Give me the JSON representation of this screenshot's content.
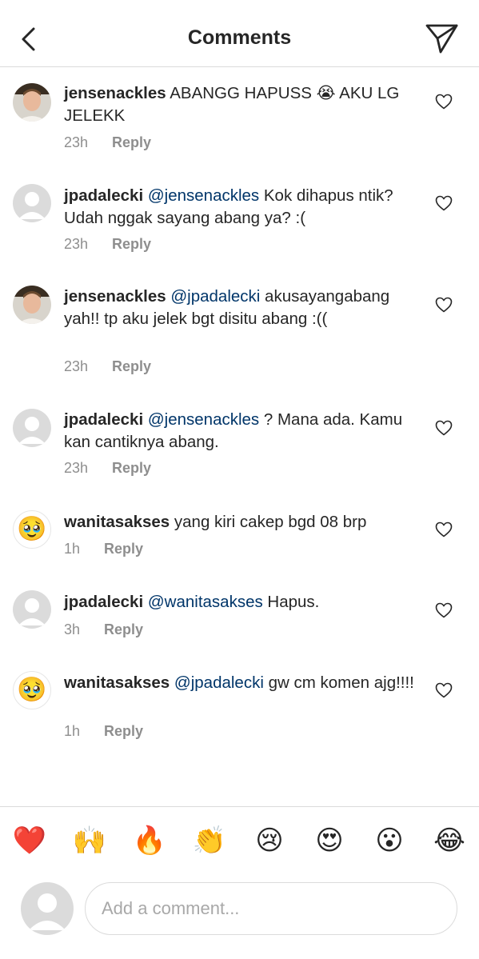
{
  "header": {
    "title": "Comments",
    "back_icon": "chevron-left-icon",
    "send_icon": "paper-plane-icon"
  },
  "comments": [
    {
      "username": "jensenackles",
      "mention": "",
      "text": "ABANGG HAPUSS 😭 AKU LG JELEKK",
      "time": "23h",
      "reply_label": "Reply",
      "avatar": "photo"
    },
    {
      "username": "jpadalecki",
      "mention": "@jensenackles",
      "text": "Kok dihapus ntik? Udah nggak sayang abang ya? :(",
      "time": "23h",
      "reply_label": "Reply",
      "avatar": "placeholder"
    },
    {
      "username": "jensenackles",
      "mention": "@jpadalecki",
      "text": "akusayangabang yah!! tp aku jelek bgt disitu abang :((",
      "time": "23h",
      "reply_label": "Reply",
      "avatar": "photo"
    },
    {
      "username": "jpadalecki",
      "mention": "@jensenackles",
      "text": "? Mana ada. Kamu kan cantiknya abang.",
      "time": "23h",
      "reply_label": "Reply",
      "avatar": "placeholder"
    },
    {
      "username": "wanitasakses",
      "mention": "",
      "text": "yang kiri cakep bgd 08 brp",
      "time": "1h",
      "reply_label": "Reply",
      "avatar": "emoji"
    },
    {
      "username": "jpadalecki",
      "mention": "@wanitasakses",
      "text": "Hapus.",
      "time": "3h",
      "reply_label": "Reply",
      "avatar": "placeholder"
    },
    {
      "username": "wanitasakses",
      "mention": "@jpadalecki",
      "text": "gw cm komen ajg!!!!",
      "time": "1h",
      "reply_label": "Reply",
      "avatar": "emoji"
    }
  ],
  "avatar_emoji": "🥹",
  "quick_reactions": [
    "❤️",
    "🙌",
    "🔥",
    "👏",
    "😢",
    "😍",
    "😮",
    "😂"
  ],
  "compose": {
    "placeholder": "Add a comment..."
  },
  "colors": {
    "mention": "#003569",
    "meta": "#8e8e8e",
    "divider": "#dbdbdb",
    "text": "#262626"
  }
}
